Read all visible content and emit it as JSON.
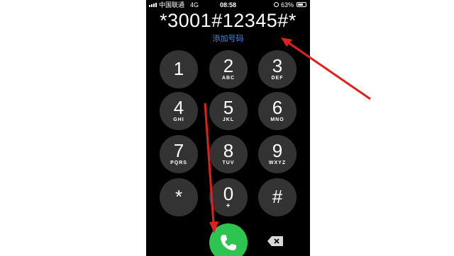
{
  "status_bar": {
    "carrier": "中国联通",
    "network": "4G",
    "time": "08:58",
    "battery_percent": "63%"
  },
  "dialer": {
    "number": "*3001#12345#*",
    "add_number_label": "添加号码"
  },
  "keypad": [
    {
      "digit": "1",
      "letters": ""
    },
    {
      "digit": "2",
      "letters": "ABC"
    },
    {
      "digit": "3",
      "letters": "DEF"
    },
    {
      "digit": "4",
      "letters": "GHI"
    },
    {
      "digit": "5",
      "letters": "JKL"
    },
    {
      "digit": "6",
      "letters": "MNO"
    },
    {
      "digit": "7",
      "letters": "PQRS"
    },
    {
      "digit": "8",
      "letters": "TUV"
    },
    {
      "digit": "9",
      "letters": "WXYZ"
    },
    {
      "digit": "*",
      "letters": ""
    },
    {
      "digit": "0",
      "letters": "+"
    },
    {
      "digit": "#",
      "letters": ""
    }
  ],
  "colors": {
    "key_background": "#333333",
    "call_button": "#2dc44f",
    "link_blue": "#3b8ef0",
    "annotation_arrow": "#e0201c"
  },
  "icons": {
    "call": "phone-handset-icon",
    "delete": "backspace-icon",
    "battery": "battery-icon",
    "signal": "signal-bars-icon"
  }
}
